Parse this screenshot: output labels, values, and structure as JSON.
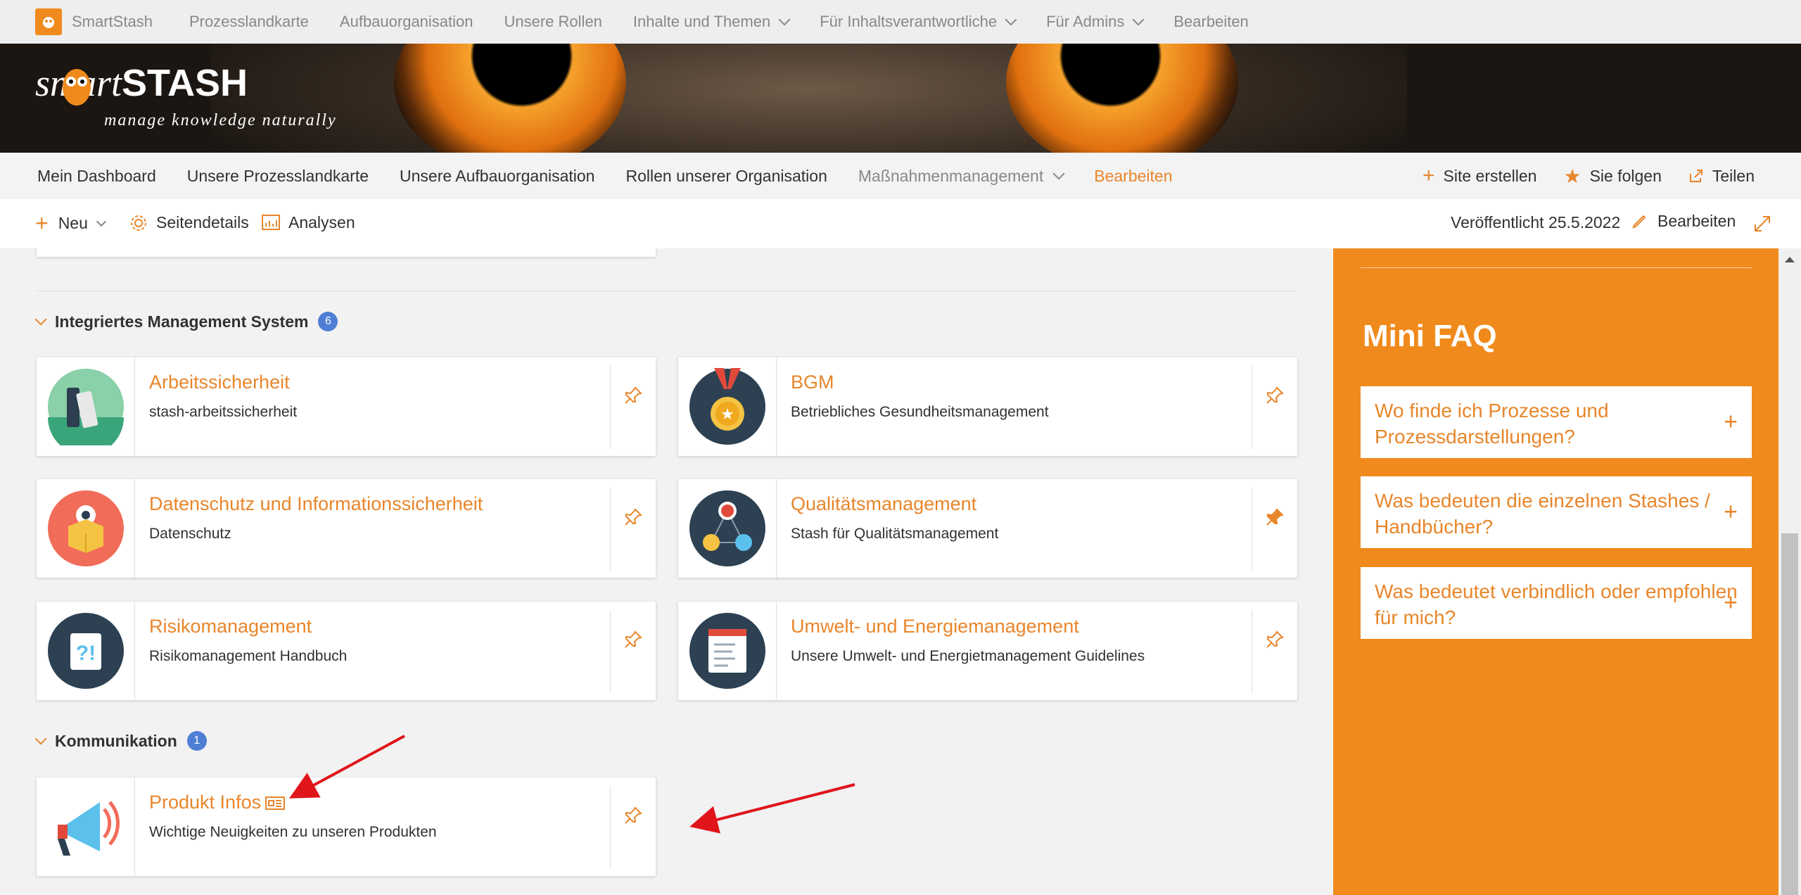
{
  "suitebar": {
    "brand": "SmartStash",
    "items": [
      "Prozesslandkarte",
      "Aufbauorganisation",
      "Unsere Rollen",
      "Inhalte und Themen",
      "Für Inhaltsverantwortliche",
      "Für Admins",
      "Bearbeiten"
    ]
  },
  "banner": {
    "logo_text_1": "smart",
    "logo_text_2": "STASH",
    "tagline": "manage knowledge naturally"
  },
  "sitenav": {
    "items": [
      "Mein Dashboard",
      "Unsere Prozesslandkarte",
      "Unsere Aufbauorganisation",
      "Rollen unserer Organisation",
      "Maßnahmenmanagement",
      "Bearbeiten"
    ],
    "site_create": "Site erstellen",
    "follow": "Sie folgen",
    "share": "Teilen"
  },
  "cmdbar": {
    "new": "Neu",
    "page_details": "Seitendetails",
    "analytics": "Analysen",
    "published": "Veröffentlicht 25.5.2022",
    "edit": "Bearbeiten"
  },
  "sections": [
    {
      "title": "Integriertes Management System",
      "count": "6",
      "cards": [
        {
          "title": "Arbeitssicherheit",
          "desc": "stash-arbeitssicherheit",
          "pinned": false
        },
        {
          "title": "BGM",
          "desc": "Betriebliches Gesundheitsmanagement",
          "pinned": false
        },
        {
          "title": "Datenschutz und Informationssicherheit",
          "desc": "Datenschutz",
          "pinned": false
        },
        {
          "title": "Qualitätsmanagement",
          "desc": "Stash für Qualitätsmanagement",
          "pinned": true
        },
        {
          "title": "Risikomanagement",
          "desc": "Risikomanagement Handbuch",
          "pinned": false
        },
        {
          "title": "Umwelt- und Energiemanagement",
          "desc": "Unsere Umwelt- und Energietmanagement Guidelines",
          "pinned": false
        }
      ]
    },
    {
      "title": "Kommunikation",
      "count": "1",
      "cards": [
        {
          "title": "Produkt Infos",
          "desc": "Wichtige Neuigkeiten zu unseren Produkten",
          "pinned": false
        }
      ]
    }
  ],
  "faq": {
    "title": "Mini FAQ",
    "items": [
      "Wo finde ich Prozesse und Prozessdarstellungen?",
      "Was bedeuten die einzelnen Stashes / Handbücher?",
      "Was bedeutet verbindlich oder empfohlen für mich?"
    ]
  },
  "colors": {
    "accent": "#e8862b",
    "faq_panel": "#f08a1c",
    "badge": "#4f7fd4",
    "annotation_arrow": "#e0151b"
  }
}
